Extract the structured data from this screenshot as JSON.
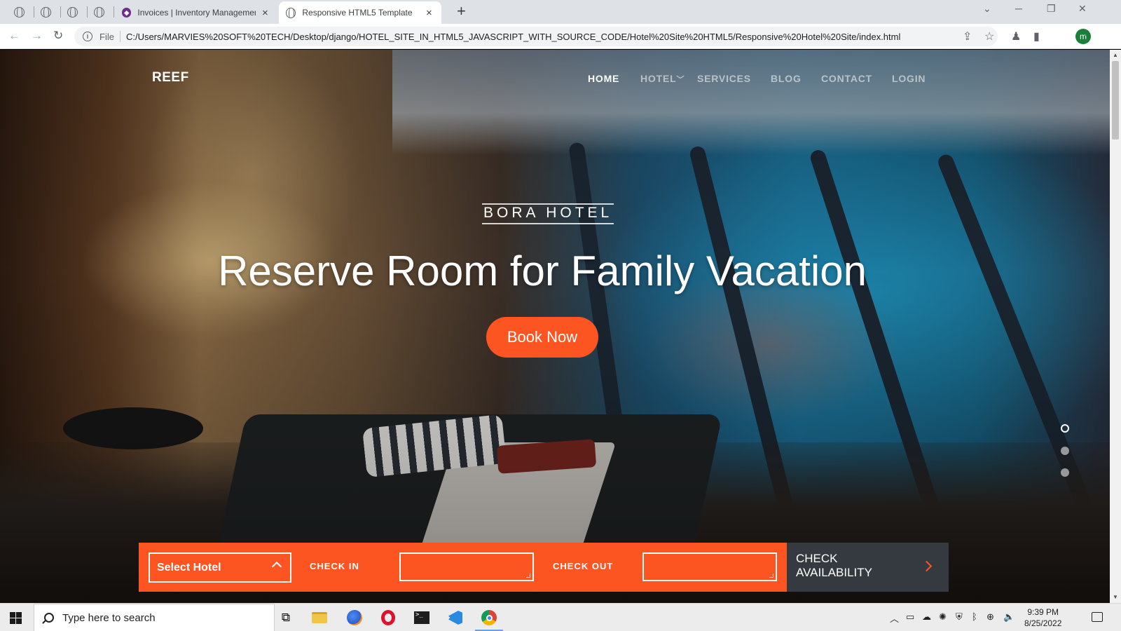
{
  "browser": {
    "tabs": [
      {
        "title": "Invoices | Inventory Managemen",
        "active": false
      },
      {
        "title": "Responsive HTML5 Template",
        "active": true
      }
    ],
    "tab_close": "×",
    "new_tab": "+",
    "window_controls": {
      "minimize": "─",
      "restore": "❐",
      "close": "✕",
      "tab_search": "⌄"
    },
    "nav": {
      "back": "←",
      "forward": "→",
      "reload": "↻"
    },
    "address": {
      "scheme_label": "File",
      "url": "C:/Users/MARVIES%20SOFT%20TECH/Desktop/django/HOTEL_SITE_IN_HTML5_JAVASCRIPT_WITH_SOURCE_CODE/Hotel%20Site%20HTML5/Responsive%20Hotel%20Site/index.html"
    },
    "profile_initial": "m"
  },
  "site": {
    "brand": "REEF",
    "menu": [
      {
        "label": "HOME",
        "active": true
      },
      {
        "label": "HOTEL",
        "active": false,
        "has_dropdown": true
      },
      {
        "label": "SERVICES",
        "active": false
      },
      {
        "label": "BLOG",
        "active": false
      },
      {
        "label": "CONTACT",
        "active": false
      },
      {
        "label": "LOGIN",
        "active": false
      }
    ],
    "hero": {
      "eyebrow": "BORA HOTEL",
      "headline": "Reserve Room for Family Vacation",
      "cta": "Book Now",
      "slides": 3,
      "active_slide": 1
    },
    "booking": {
      "select_hotel": "Select Hotel",
      "check_in_label": "CHECK IN",
      "check_in_value": "",
      "check_out_label": "CHECK OUT",
      "check_out_value": "",
      "check_availability_line1": "CHECK",
      "check_availability_line2": "AVAILABILITY"
    },
    "colors": {
      "accent": "#fd5522",
      "dark": "#353a40"
    }
  },
  "taskbar": {
    "search_placeholder": "Type here to search",
    "apps": [
      "task-view-icon",
      "file-explorer-icon",
      "firefox-icon",
      "opera-icon",
      "terminal-icon",
      "vscode-icon",
      "chrome-icon"
    ],
    "time": "9:39 PM",
    "date": "8/25/2022"
  }
}
